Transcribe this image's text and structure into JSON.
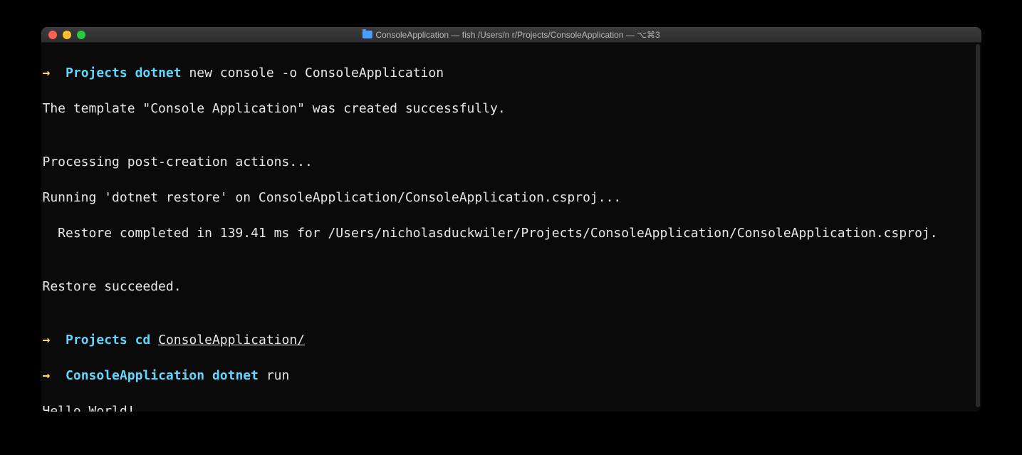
{
  "window": {
    "title": "ConsoleApplication — fish  /Users/n              r/Projects/ConsoleApplication — ⌥⌘3"
  },
  "prompts": {
    "arrow": "→",
    "dir1": "Projects",
    "dir2": "ConsoleApplication"
  },
  "commands": {
    "cmd1_main": "dotnet",
    "cmd1_args": "new console -o ConsoleApplication",
    "cmd2_main": "cd",
    "cmd2_args": "ConsoleApplication/",
    "cmd3_main": "dotnet",
    "cmd3_args": "run"
  },
  "output": {
    "line1": "The template \"Console Application\" was created successfully.",
    "line2": "",
    "line3": "Processing post-creation actions...",
    "line4": "Running 'dotnet restore' on ConsoleApplication/ConsoleApplication.csproj...",
    "line5": "  Restore completed in 139.41 ms for /Users/nicholasduckwiler/Projects/ConsoleApplication/ConsoleApplication.csproj.",
    "line6": "",
    "line7": "Restore succeeded.",
    "line8": "",
    "line9": "Hello World!"
  }
}
